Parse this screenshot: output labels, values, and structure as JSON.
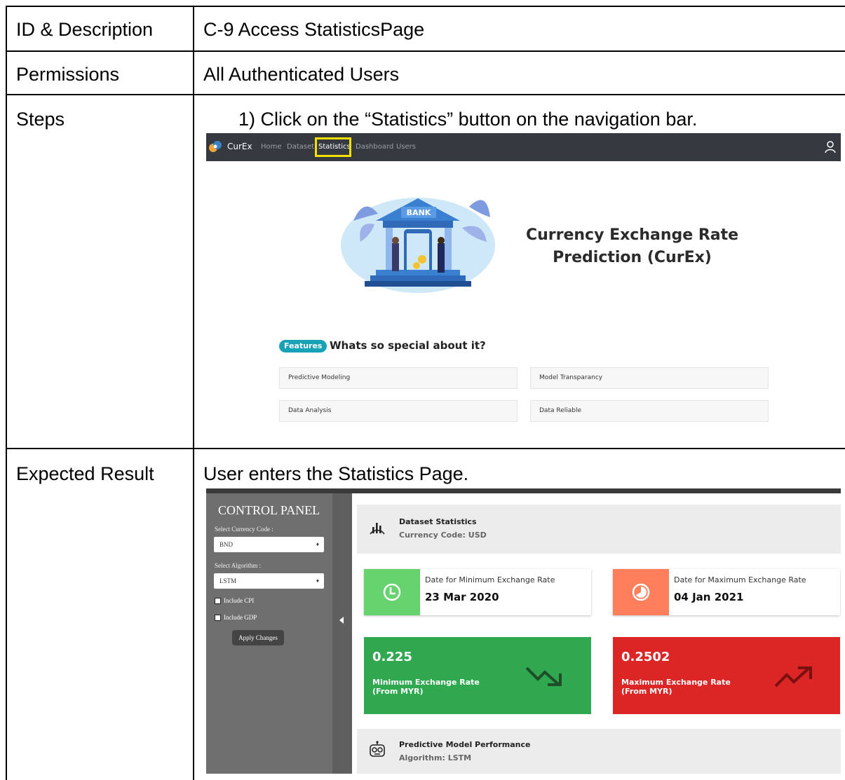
{
  "table": {
    "rows": [
      {
        "label": "ID & Description",
        "value": "C-9 Access StatisticsPage"
      },
      {
        "label": "Permissions",
        "value": "All Authenticated Users"
      },
      {
        "label": "Steps",
        "value": "1)  Click on the “Statistics” button on the navigation bar."
      },
      {
        "label": "Expected Result",
        "value": "User enters the Statistics Page."
      }
    ]
  },
  "shot1": {
    "brand": "CurEx",
    "nav": [
      "Home",
      "Dataset",
      "Statistics",
      "Dashboard",
      "Users"
    ],
    "bank_sign": "BANK",
    "hero_line1": "Currency Exchange Rate",
    "hero_line2": "Prediction (CurEx)",
    "features_badge": "Features",
    "features_question": "Whats so special about it?",
    "features": [
      "Predictive Modeling",
      "Model Transparancy",
      "Data Analysis",
      "Data Reliable"
    ]
  },
  "shot2": {
    "panel_title": "CONTROL PANEL",
    "currency_label": "Select Currency Code :",
    "currency_value": "BND",
    "algorithm_label": "Select Algorithm :",
    "algorithm_value": "LSTM",
    "include_cpi": "Include CPI",
    "include_gdp": "Include GDP",
    "apply_button": "Apply Changes",
    "dataset_title": "Dataset Statistics",
    "dataset_sub": "Currency Code: USD",
    "min_date_label": "Date for Minimum Exchange Rate",
    "min_date": "23 Mar 2020",
    "max_date_label": "Date for Maximum Exchange Rate",
    "max_date": "04 Jan 2021",
    "min_value": "0.225",
    "min_label_1": "Minimum Exchange Rate",
    "min_label_2": "(From MYR)",
    "max_value": "0.2502",
    "max_label_1": "Maximum Exchange Rate",
    "max_label_2": "(From MYR)",
    "model_title": "Predictive Model Performance",
    "model_sub": "Algorithm: LSTM"
  },
  "colors": {
    "navbar": "#343a40",
    "highlight": "#f5e000",
    "badge": "#17a2b8",
    "green_light": "#66d36e",
    "orange": "#ff7f5c",
    "green": "#2fa84f",
    "red": "#dc2626",
    "panel": "#6f6f6f"
  }
}
